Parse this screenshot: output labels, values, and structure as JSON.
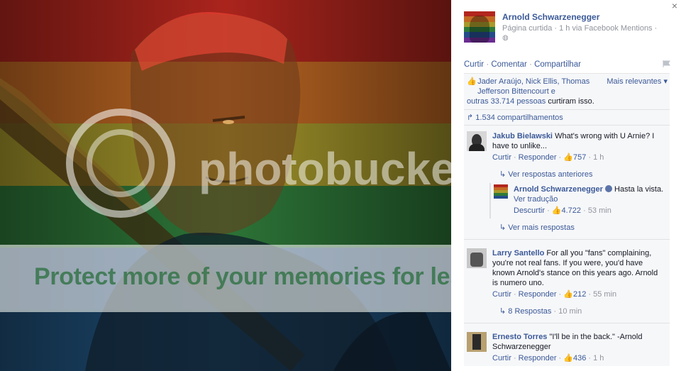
{
  "watermark": {
    "banner_text": "Protect more of your memories for less!"
  },
  "photo": {
    "stripes": [
      "#c62828",
      "#d9822b",
      "#c9b233",
      "#2e8b3e",
      "#2a4f9c",
      "#6a2c91"
    ]
  },
  "panel": {
    "close_glyph": "×",
    "author": {
      "name": "Arnold Schwarzenegger",
      "meta": "Página curtida · 1 h via Facebook Mentions ·",
      "privacy_icon": "globe-icon"
    },
    "actions": {
      "like": "Curtir",
      "comment": "Comentar",
      "share": "Compartilhar"
    },
    "likes_summary": {
      "names": "Jader Araújo, Nick Ellis, Thomas Jefferson Bittencourt e",
      "others": "outras 33.714 pessoas",
      "suffix": "curtiram isso.",
      "sort": "Mais relevantes"
    },
    "shares": "1.534 compartilhamentos",
    "comments": [
      {
        "name": "Jakub Bielawski",
        "text": "What's wrong with U Arnie? I have to unlike...",
        "like": "Curtir",
        "reply": "Responder",
        "likes": "757",
        "time": "1 h",
        "previous_replies": "Ver respostas anteriores",
        "reply_item": {
          "name": "Arnold Schwarzenegger",
          "text": "Hasta la vista.",
          "translate": "Ver tradução",
          "unlike": "Descurtir",
          "likes": "4.722",
          "time": "53 min"
        },
        "more_replies": "Ver mais respostas"
      },
      {
        "name": "Larry Santello",
        "text": "For all you \"fans\" complaining, you're not real fans. If you were, you'd have known Arnold's stance on this years ago. Arnold is numero uno.",
        "like": "Curtir",
        "reply": "Responder",
        "likes": "212",
        "time": "55 min",
        "replies_link": "8 Respostas",
        "replies_time": "10 min"
      },
      {
        "name": "Ernesto Torres",
        "text": "\"I'll be in the back.\" -Arnold Schwarzenegger",
        "like": "Curtir",
        "reply": "Responder",
        "likes": "436",
        "time": "1 h"
      }
    ]
  }
}
